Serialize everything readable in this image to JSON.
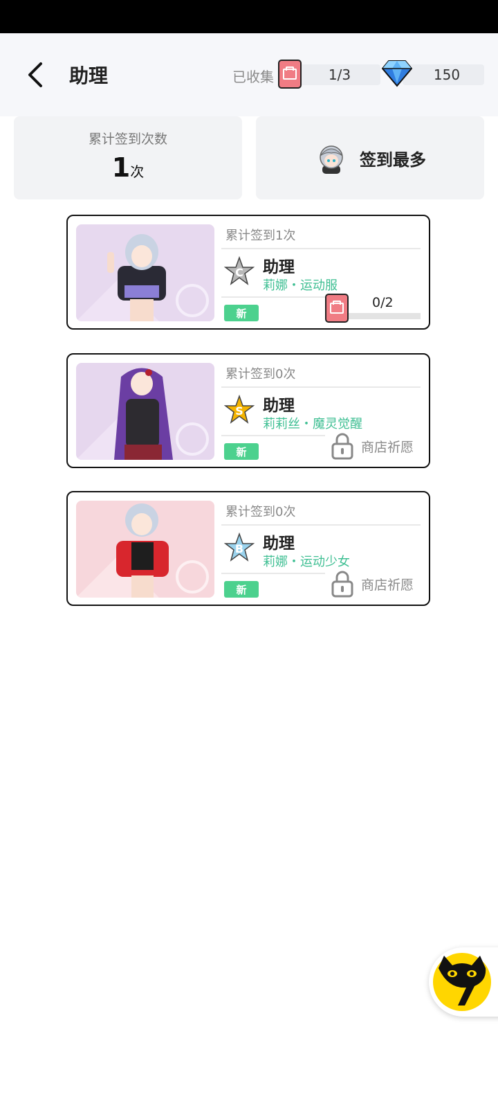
{
  "header": {
    "title": "助理",
    "collected_label": "已收集",
    "collected_value": "1/3",
    "gems": "150"
  },
  "stats": {
    "total_label": "累计签到次数",
    "total_value": "1",
    "total_unit": "次",
    "most_label": "签到最多"
  },
  "items": [
    {
      "count_text": "累计签到1次",
      "title": "助理",
      "subtitle": "莉娜・运动服",
      "rank": "C",
      "badge": "新",
      "progress_text": "0/2",
      "progress": 0,
      "locked": false
    },
    {
      "count_text": "累计签到0次",
      "title": "助理",
      "subtitle": "莉莉丝・魔灵觉醒",
      "rank": "S",
      "badge": "新",
      "lock_label": "商店祈愿",
      "locked": true
    },
    {
      "count_text": "累计签到0次",
      "title": "助理",
      "subtitle": "莉娜・运动少女",
      "rank": "B",
      "badge": "新",
      "lock_label": "商店祈愿",
      "locked": true
    }
  ],
  "colors": {
    "accent_green": "#4cd18e",
    "subtitle_green": "#3fbf93",
    "card_red": "#f07c84",
    "rank_c": "#9e9e9e",
    "rank_s": "#f5b400",
    "rank_b": "#7cc7e8"
  }
}
